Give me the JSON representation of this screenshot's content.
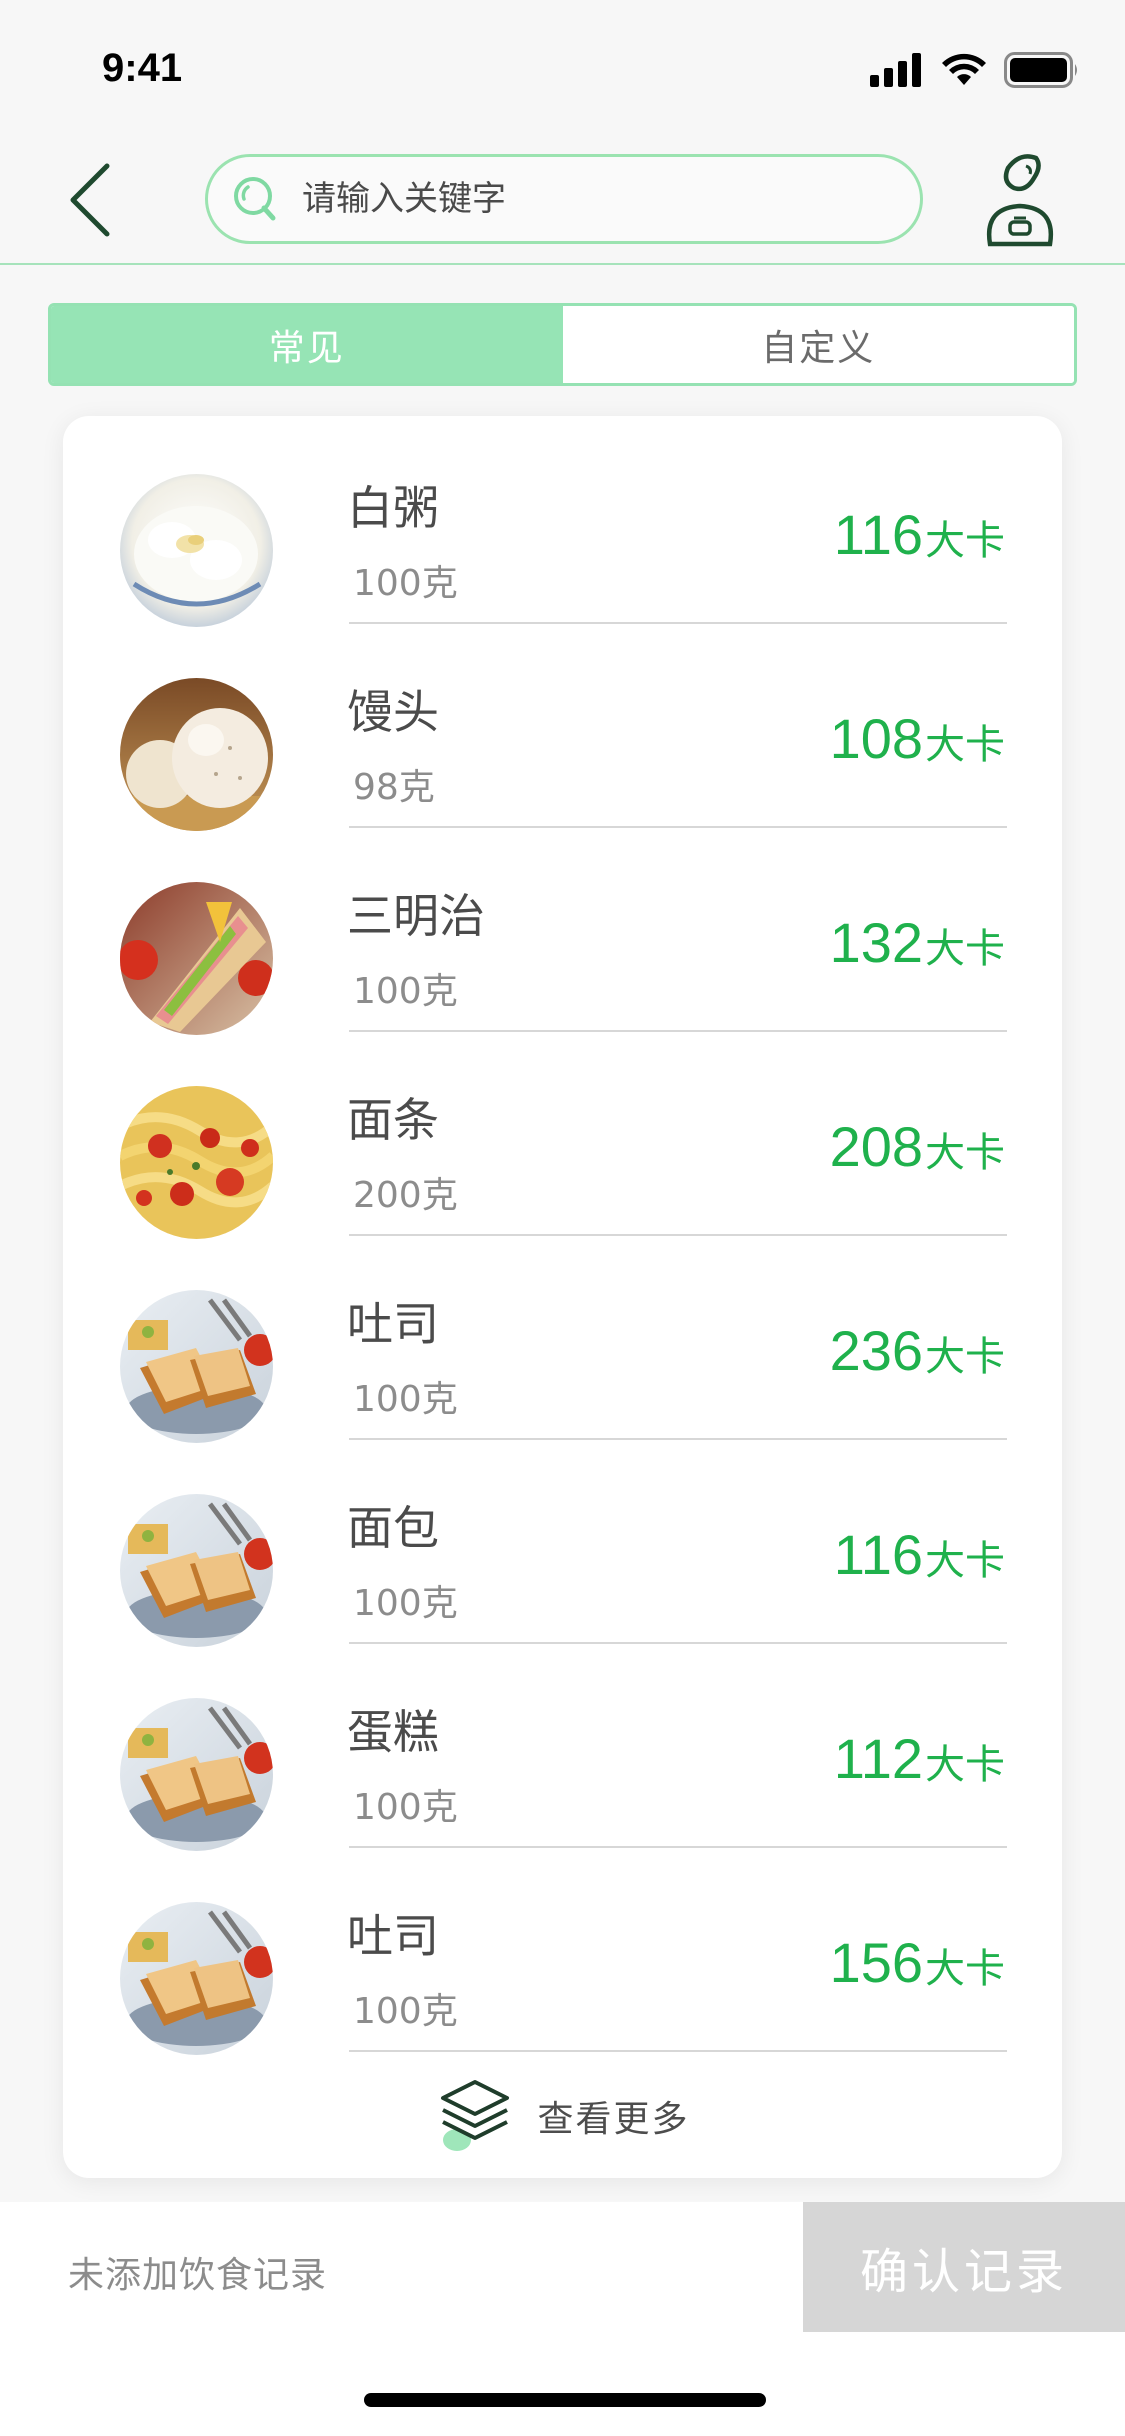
{
  "status_bar": {
    "time": "9:41"
  },
  "search": {
    "placeholder": "请输入关键字"
  },
  "tabs": [
    {
      "label": "常见",
      "active": true
    },
    {
      "label": "自定义",
      "active": false
    }
  ],
  "food_items": [
    {
      "name": "白粥",
      "weight": "100克",
      "kcal": "116",
      "unit": "大卡",
      "image": "rice-porridge"
    },
    {
      "name": "馒头",
      "weight": "98克",
      "kcal": "108",
      "unit": "大卡",
      "image": "steamed-bun"
    },
    {
      "name": "三明治",
      "weight": "100克",
      "kcal": "132",
      "unit": "大卡",
      "image": "sandwich"
    },
    {
      "name": "面条",
      "weight": "200克",
      "kcal": "208",
      "unit": "大卡",
      "image": "noodles"
    },
    {
      "name": "吐司",
      "weight": "100克",
      "kcal": "236",
      "unit": "大卡",
      "image": "toast"
    },
    {
      "name": "面包",
      "weight": "100克",
      "kcal": "116",
      "unit": "大卡",
      "image": "toast"
    },
    {
      "name": "蛋糕",
      "weight": "100克",
      "kcal": "112",
      "unit": "大卡",
      "image": "toast"
    },
    {
      "name": "吐司",
      "weight": "100克",
      "kcal": "156",
      "unit": "大卡",
      "image": "toast"
    }
  ],
  "more": {
    "label": "查看更多",
    "icon": "layers-icon"
  },
  "bottom_bar": {
    "status_text": "未添加饮食记录",
    "confirm_label": "确认记录"
  },
  "colors": {
    "accent": "#1fb14c",
    "tab_active": "#96e4b5",
    "border": "#9be3b0",
    "confirm_disabled": "#d6d6d6"
  }
}
